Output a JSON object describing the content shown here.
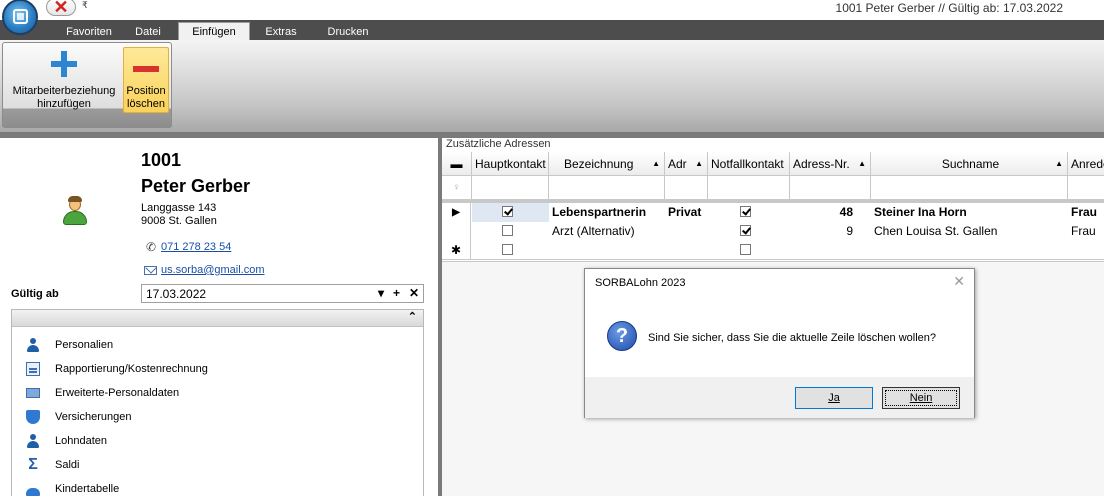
{
  "window": {
    "title": "1001 Peter Gerber // Gültig ab: 17.03.2022",
    "qat_close_glyph": "✕",
    "qat_dropdown_glyph": "₹"
  },
  "tabs": [
    "Favoriten",
    "Datei",
    "Einfügen",
    "Extras",
    "Drucken"
  ],
  "active_tab": "Einfügen",
  "ribbon": {
    "add_line1": "Mitarbeiterbeziehung",
    "add_line2": "hinzufügen",
    "del_line1": "Position",
    "del_line2": "löschen"
  },
  "employee": {
    "id": "1001",
    "name": "Peter Gerber",
    "street": "Langgasse 143",
    "city": "9008 St. Gallen",
    "phone": "071 278 23 54",
    "email": "us.sorba@gmail.com"
  },
  "valid_from": {
    "label": "Gültig ab",
    "value": "17.03.2022",
    "dropdown_glyph": "▾",
    "add_glyph": "+",
    "clear_glyph": "✕"
  },
  "nav": {
    "collapse_glyph": "⌃",
    "items": [
      {
        "label": "Personalien",
        "icon": "person-icon"
      },
      {
        "label": "Rapportierung/Kostenrechnung",
        "icon": "report-icon"
      },
      {
        "label": "Erweiterte-Personaldaten",
        "icon": "id-card-icon"
      },
      {
        "label": "Versicherungen",
        "icon": "shield-icon"
      },
      {
        "label": "Lohndaten",
        "icon": "person-icon"
      },
      {
        "label": "Saldi",
        "icon": "sigma-icon"
      },
      {
        "label": "Kindertabelle",
        "icon": "group-icon"
      }
    ]
  },
  "grid": {
    "section_title": "Zusätzliche Adressen",
    "header_glyph": "▬",
    "filter_glyph": "♀",
    "sort_glyph": "▲",
    "columns": [
      "Hauptkontakt",
      "Bezeichnung",
      "Adr",
      "Notfallkontakt",
      "Adress-Nr.",
      "Suchname",
      "Anrede"
    ],
    "rows": [
      {
        "indicator": "▶",
        "hauptkontakt": true,
        "bezeichnung": "Lebenspartnerin",
        "adr": "Privat",
        "notfall": true,
        "adress_nr": "48",
        "suchname": "Steiner Ina Horn",
        "anrede": "Frau"
      },
      {
        "indicator": "",
        "hauptkontakt": false,
        "bezeichnung": "Arzt (Alternativ)",
        "adr": "",
        "notfall": true,
        "adress_nr": "9",
        "suchname": "Chen Louisa St. Gallen",
        "anrede": "Frau"
      }
    ],
    "new_row_indicator": "✱"
  },
  "dialog": {
    "title": "SORBALohn  2023",
    "close_glyph": "✕",
    "icon_glyph": "?",
    "message": "Sind Sie sicher, dass Sie die aktuelle Zeile löschen wollen?",
    "yes": "Ja",
    "no": "Nein"
  },
  "colors": {
    "ribbon_highlight": "#fbd25a",
    "tab_strip": "#4d4d4d",
    "link": "#1a4fa8",
    "accent_blue": "#2d86d2",
    "delete_red": "#d8322c"
  }
}
